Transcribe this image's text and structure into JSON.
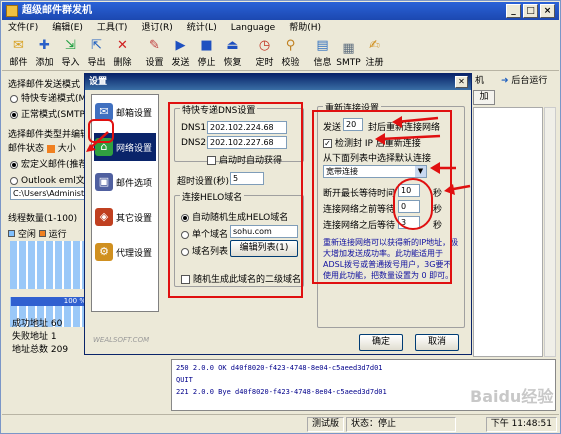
{
  "app": {
    "title": "超级邮件群发机"
  },
  "menu": [
    "文件(F)",
    "编辑(E)",
    "工具(T)",
    "退订(R)",
    "统计(L)",
    "Language",
    "帮助(H)"
  ],
  "toolbar": [
    "邮件",
    "添加",
    "导入",
    "导出",
    "删除",
    "设置",
    "发送",
    "停止",
    "恢复",
    "定时",
    "校验",
    "信息",
    "SMTP",
    "注册"
  ],
  "left": {
    "mode_label": "选择邮件发送模式",
    "mode_special": "特快专递模式(MX)",
    "mode_normal": "正常模式(SMTP)",
    "type_label": "选择邮件类型并编辑",
    "status_label": "邮件状态",
    "status_size": "大小",
    "custom_mail": "宏定义邮件(推荐)",
    "outlook": "Outlook eml文件",
    "path": "C:\\Users\\Administ",
    "threads": "线程数量(1-100)",
    "legend_idle": "空闲",
    "legend_run": "运行",
    "progress": "100 %",
    "success_label": "成功地址",
    "success_value": "60",
    "fail_label": "失败地址",
    "fail_value": "1",
    "total_label": "地址总数",
    "total_value": "209"
  },
  "right_bg": {
    "machine": "机",
    "bg_run": "后台运行",
    "add": "加"
  },
  "log": {
    "lines": [
      "250 2.0.0 OK d40f8020-f423-4748-8e04-c5aeed3d7d01",
      "QUIT",
      "221 2.0.0 Bye d40f8020-f423-4748-8e04-c5aeed3d7d01"
    ]
  },
  "statusbar": {
    "test_version": "测试版",
    "state": "状态：停止",
    "time": "下午 11:48:51"
  },
  "dialog": {
    "title": "设置",
    "nav": [
      "邮箱设置",
      "网络设置",
      "邮件选项",
      "其它设置",
      "代理设置"
    ],
    "dns_group": "特快专递DNS设置",
    "dns1_label": "DNS1",
    "dns1": "202.102.224.68",
    "dns2_label": "DNS2",
    "dns2": "202.102.227.68",
    "auto_dns": "启动时自动获得",
    "timeout_label": "超时设置(秒)",
    "timeout": "5",
    "helo_group": "连接HELO域名",
    "helo_auto": "自动随机生成HELO域名",
    "helo_single": "单个域名",
    "helo_single_value": "sohu.com",
    "helo_list": "域名列表",
    "edit_list": "编辑列表(1)",
    "random_sub": "随机生成此域名的二级域名",
    "reconnect_group": "重新连接设置",
    "send_label": "发送",
    "send_count": "20",
    "send_suffix": "封后重新连接网络",
    "ip_check": "检测封 IP 后重新连接",
    "select_default": "从下面列表中选择默认连接",
    "conn_select": "宽带连接",
    "max_wait_label": "断开最长等待时间",
    "max_wait": "10",
    "sec1": "秒",
    "before_wait_label": "连接网络之前等待",
    "before_wait": "0",
    "sec2": "秒",
    "after_wait_label": "连接网络之后等待",
    "after_wait": "3",
    "sec3": "秒",
    "note": "重新连接网络可以获得新的IP地址，极大增加发送成功率。此功能适用于ADSL拨号或普通拨号用户，3G要不使用此功能，把数量设置为 0 即可。",
    "site": "WEALSOFT.COM",
    "ok": "确定",
    "cancel": "取消"
  },
  "watermark": "Baidu经验"
}
